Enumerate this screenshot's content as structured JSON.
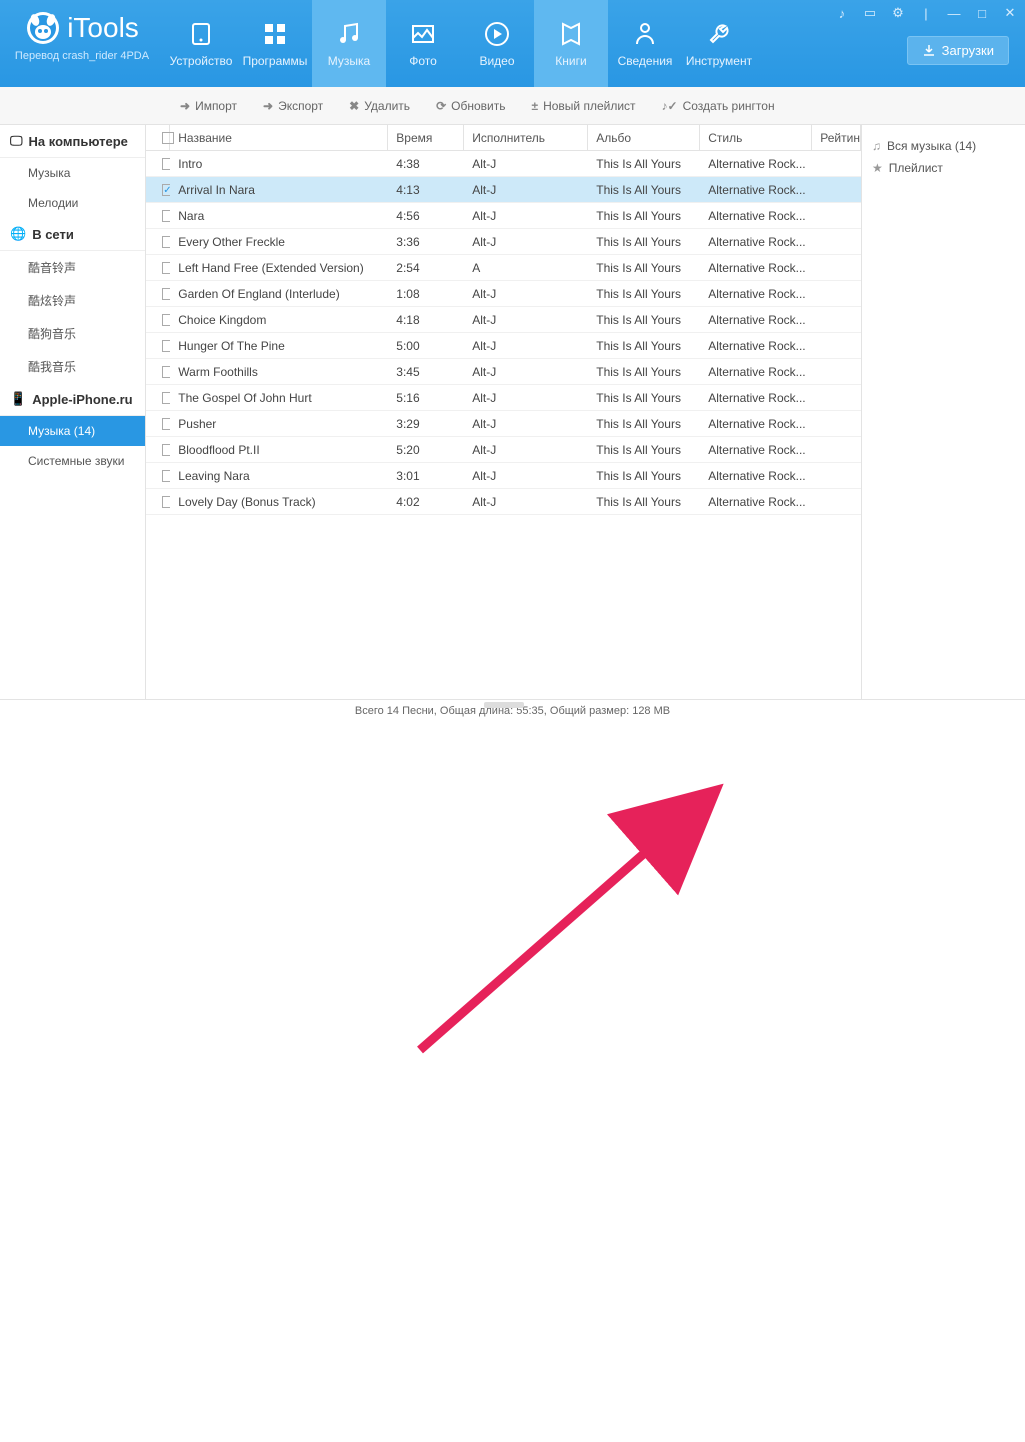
{
  "app": {
    "title": "iTools",
    "subtitle": "Перевод crash_rider 4PDA"
  },
  "nav": [
    {
      "label": "Устройство",
      "icon": "device"
    },
    {
      "label": "Программы",
      "icon": "apps"
    },
    {
      "label": "Музыка",
      "icon": "music",
      "active": true
    },
    {
      "label": "Фото",
      "icon": "photo"
    },
    {
      "label": "Видео",
      "icon": "video"
    },
    {
      "label": "Книги",
      "icon": "books",
      "active": true
    },
    {
      "label": "Сведения",
      "icon": "info"
    },
    {
      "label": "Инструмент",
      "icon": "tools"
    }
  ],
  "downloads": "Загрузки",
  "toolbar": [
    {
      "label": "Импорт",
      "icon": "import"
    },
    {
      "label": "Экспорт",
      "icon": "export"
    },
    {
      "label": "Удалить",
      "icon": "delete"
    },
    {
      "label": "Обновить",
      "icon": "refresh"
    },
    {
      "label": "Новый плейлист",
      "icon": "newlist"
    },
    {
      "label": "Создать рингтон",
      "icon": "ringtone"
    }
  ],
  "sidebar_left": [
    {
      "type": "section",
      "label": "На компьютере",
      "icon": "computer"
    },
    {
      "type": "item",
      "label": "Музыка"
    },
    {
      "type": "item",
      "label": "Мелодии"
    },
    {
      "type": "section",
      "label": "В сети",
      "icon": "globe"
    },
    {
      "type": "item",
      "label": "酷音铃声"
    },
    {
      "type": "item",
      "label": "酷炫铃声"
    },
    {
      "type": "item",
      "label": "酷狗音乐"
    },
    {
      "type": "item",
      "label": "酷我音乐"
    },
    {
      "type": "section",
      "label": "Apple-iPhone.ru",
      "icon": "phone"
    },
    {
      "type": "item",
      "label": "Музыка (14)",
      "active": true
    },
    {
      "type": "item",
      "label": "Системные звуки"
    }
  ],
  "columns": {
    "name": "Название",
    "time": "Время",
    "artist": "Исполнитель",
    "album": "Альбо",
    "style": "Стиль",
    "rating": "Рейтин"
  },
  "songs": [
    {
      "name": "Intro",
      "time": "4:38",
      "artist": "Alt-J",
      "album": "This Is All Yours",
      "style": "Alternative Rock..."
    },
    {
      "name": "Arrival In Nara",
      "time": "4:13",
      "artist": "Alt-J",
      "album": "This Is All Yours",
      "style": "Alternative Rock...",
      "selected": true,
      "checked": true
    },
    {
      "name": "Nara",
      "time": "4:56",
      "artist": "Alt-J",
      "album": "This Is All Yours",
      "style": "Alternative Rock..."
    },
    {
      "name": "Every Other Freckle",
      "time": "3:36",
      "artist": "Alt-J",
      "album": "This Is All Yours",
      "style": "Alternative Rock..."
    },
    {
      "name": "Left Hand Free (Extended Version)",
      "time": "2:54",
      "artist": "A",
      "album": "This Is All Yours",
      "style": "Alternative Rock..."
    },
    {
      "name": "Garden Of England (Interlude)",
      "time": "1:08",
      "artist": "Alt-J",
      "album": "This Is All Yours",
      "style": "Alternative Rock..."
    },
    {
      "name": "Choice Kingdom",
      "time": "4:18",
      "artist": "Alt-J",
      "album": "This Is All Yours",
      "style": "Alternative Rock..."
    },
    {
      "name": "Hunger Of The Pine",
      "time": "5:00",
      "artist": "Alt-J",
      "album": "This Is All Yours",
      "style": "Alternative Rock..."
    },
    {
      "name": "Warm Foothills",
      "time": "3:45",
      "artist": "Alt-J",
      "album": "This Is All Yours",
      "style": "Alternative Rock..."
    },
    {
      "name": "The Gospel Of John Hurt",
      "time": "5:16",
      "artist": "Alt-J",
      "album": "This Is All Yours",
      "style": "Alternative Rock..."
    },
    {
      "name": "Pusher",
      "time": "3:29",
      "artist": "Alt-J",
      "album": "This Is All Yours",
      "style": "Alternative Rock..."
    },
    {
      "name": "Bloodflood Pt.II",
      "time": "5:20",
      "artist": "Alt-J",
      "album": "This Is All Yours",
      "style": "Alternative Rock..."
    },
    {
      "name": "Leaving Nara",
      "time": "3:01",
      "artist": "Alt-J",
      "album": "This Is All Yours",
      "style": "Alternative Rock..."
    },
    {
      "name": "Lovely Day (Bonus Track)",
      "time": "4:02",
      "artist": "Alt-J",
      "album": "This Is All Yours",
      "style": "Alternative Rock..."
    }
  ],
  "sidebar_right": [
    {
      "label": "Вся музыка (14)",
      "icon": "note"
    },
    {
      "label": "Плейлист",
      "icon": "star"
    }
  ],
  "status": "Всего 14 Песни, Общая длина: 55:35, Общий размер: 128 MB"
}
